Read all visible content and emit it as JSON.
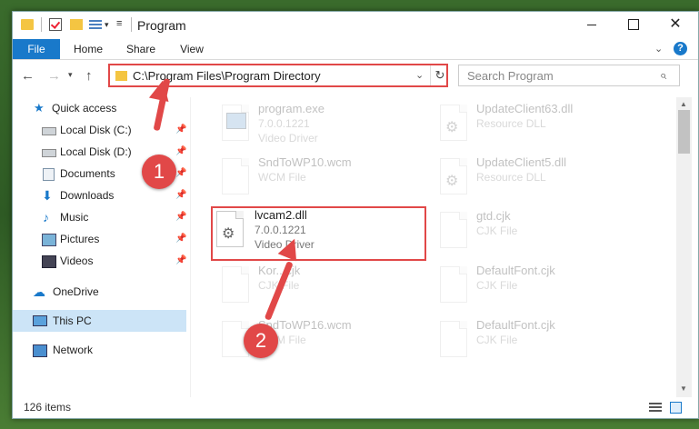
{
  "window": {
    "title": "Program",
    "controls": {
      "minimize": "",
      "maximize": "",
      "close": "✕"
    }
  },
  "ribbon": {
    "tabs": [
      "File",
      "Home",
      "Share",
      "View"
    ],
    "help": "?"
  },
  "address": {
    "path": "C:\\Program Files\\Program Directory"
  },
  "search": {
    "placeholder": "Search Program"
  },
  "sidebar": {
    "items": [
      {
        "label": "Quick access",
        "icon": "star-icon"
      },
      {
        "label": "Local Disk (C:)",
        "icon": "disk-icon",
        "pinned": true
      },
      {
        "label": "Local Disk (D:)",
        "icon": "disk-icon",
        "pinned": true
      },
      {
        "label": "Documents",
        "icon": "documents-icon",
        "pinned": true
      },
      {
        "label": "Downloads",
        "icon": "downloads-icon",
        "pinned": true
      },
      {
        "label": "Music",
        "icon": "music-icon",
        "pinned": true
      },
      {
        "label": "Pictures",
        "icon": "pictures-icon",
        "pinned": true
      },
      {
        "label": "Videos",
        "icon": "videos-icon",
        "pinned": true
      },
      {
        "label": "OneDrive",
        "icon": "onedrive-icon"
      },
      {
        "label": "This PC",
        "icon": "this-pc-icon",
        "selected": true
      },
      {
        "label": "Network",
        "icon": "network-icon"
      }
    ]
  },
  "files": [
    {
      "name": "program.exe",
      "line2": "7.0.0.1221",
      "line3": "Video Driver",
      "icon": "exe-icon"
    },
    {
      "name": "UpdateClient63.dll",
      "line2": "Resource DLL",
      "line3": "",
      "icon": "dll-icon"
    },
    {
      "name": "SndToWP10.wcm",
      "line2": "WCM File",
      "line3": "",
      "icon": "file-icon"
    },
    {
      "name": "UpdateClient5.dll",
      "line2": "Resource DLL",
      "line3": "",
      "icon": "dll-icon"
    },
    {
      "name": "lvcam2.dll",
      "line2": "7.0.0.1221",
      "line3": "Video Driver",
      "icon": "dll-icon"
    },
    {
      "name": "gtd.cjk",
      "line2": "CJK File",
      "line3": "",
      "icon": "file-icon"
    },
    {
      "name": "Kor...cjk",
      "line2": "CJK File",
      "line3": "",
      "icon": "file-icon"
    },
    {
      "name": "DefaultFont.cjk",
      "line2": "CJK File",
      "line3": "",
      "icon": "file-icon"
    },
    {
      "name": "SndToWP16.wcm",
      "line2": "WCM File",
      "line3": "",
      "icon": "file-icon"
    },
    {
      "name": "DefaultFont.cjk",
      "line2": "CJK File",
      "line3": "",
      "icon": "file-icon"
    }
  ],
  "status": {
    "count": "126 items"
  },
  "annotations": {
    "callout1": "1",
    "callout2": "2"
  },
  "colors": {
    "accent": "#1979ca",
    "highlight": "#e14848",
    "selected": "#cce4f7"
  }
}
